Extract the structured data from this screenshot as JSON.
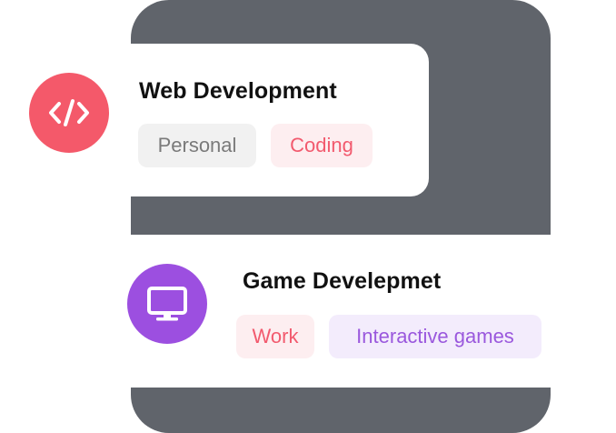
{
  "colors": {
    "backdrop": "#60646b",
    "web_icon_bg": "#f4596a",
    "game_icon_bg": "#9c4fe0",
    "tag_personal_bg": "#f1f1f1",
    "tag_personal_fg": "#7a7a7a",
    "tag_pink_bg": "#fdeef0",
    "tag_pink_fg": "#f25a6e",
    "tag_purple_bg": "#f3ecfc",
    "tag_purple_fg": "#9a58dd"
  },
  "cards": {
    "web": {
      "icon": "code-icon",
      "title": "Web Development",
      "tags": [
        "Personal",
        "Coding"
      ]
    },
    "game": {
      "icon": "monitor-icon",
      "title": "Game Develepmet",
      "tags": [
        "Work",
        "Interactive games"
      ]
    }
  }
}
